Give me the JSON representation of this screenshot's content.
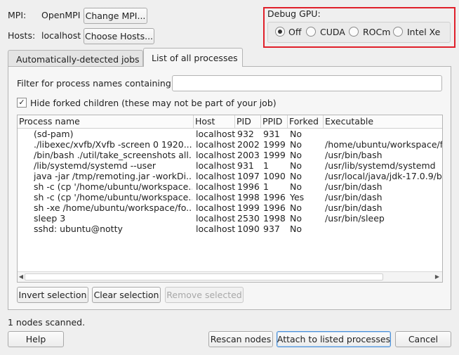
{
  "mpi": {
    "label": "MPI:",
    "value": "OpenMPI",
    "change_button": "Change MPI..."
  },
  "hosts": {
    "label": "Hosts:",
    "value": "localhost",
    "choose_button": "Choose Hosts..."
  },
  "debug_gpu": {
    "title": "Debug GPU:",
    "options": [
      "Off",
      "CUDA",
      "ROCm",
      "Intel Xe"
    ],
    "selected": "Off",
    "highlight_color": "#e0202a"
  },
  "tabs": [
    "Automatically-detected jobs",
    "List of all processes"
  ],
  "active_tab": "List of all processes",
  "filter": {
    "label": "Filter for process names containing:",
    "value": ""
  },
  "hide_forked": {
    "label": "Hide forked children (these may not be part of your job)",
    "checked": true
  },
  "table": {
    "columns": [
      "Process name",
      "Host",
      "PID",
      "PPID",
      "Forked",
      "Executable"
    ],
    "rows": [
      [
        "(sd-pam)",
        "localhost",
        "932",
        "931",
        "No",
        ""
      ],
      [
        "./libexec/xvfb/Xvfb -screen 0 1920...",
        "localhost",
        "2002",
        "1999",
        "No",
        "/home/ubuntu/workspace/fo"
      ],
      [
        "/bin/bash ./util/take_screenshots all...",
        "localhost",
        "2003",
        "1999",
        "No",
        "/usr/bin/bash"
      ],
      [
        "/lib/systemd/systemd --user",
        "localhost",
        "931",
        "1",
        "No",
        "/usr/lib/systemd/systemd"
      ],
      [
        "java -jar /tmp/remoting.jar -workDi...",
        "localhost",
        "1097",
        "1090",
        "No",
        "/usr/local/java/jdk-17.0.9/bin"
      ],
      [
        "sh -c (cp '/home/ubuntu/workspace...",
        "localhost",
        "1996",
        "1",
        "No",
        "/usr/bin/dash"
      ],
      [
        "sh -c (cp '/home/ubuntu/workspace...",
        "localhost",
        "1998",
        "1996",
        "Yes",
        "/usr/bin/dash"
      ],
      [
        "sh -xe /home/ubuntu/workspace/fo...",
        "localhost",
        "1999",
        "1996",
        "No",
        "/usr/bin/dash"
      ],
      [
        "sleep 3",
        "localhost",
        "2530",
        "1998",
        "No",
        "/usr/bin/sleep"
      ],
      [
        "sshd: ubuntu@notty",
        "localhost",
        "1090",
        "937",
        "No",
        ""
      ]
    ]
  },
  "table_buttons": {
    "invert": "Invert selection",
    "clear": "Clear selection",
    "remove": "Remove selected"
  },
  "status": "1 nodes scanned.",
  "footer": {
    "help": "Help",
    "rescan": "Rescan nodes",
    "attach": "Attach to listed processes",
    "cancel": "Cancel"
  },
  "icons": {
    "checkmark": "check-icon",
    "scroll_left": "arrow-left-icon",
    "scroll_right": "arrow-right-icon"
  }
}
